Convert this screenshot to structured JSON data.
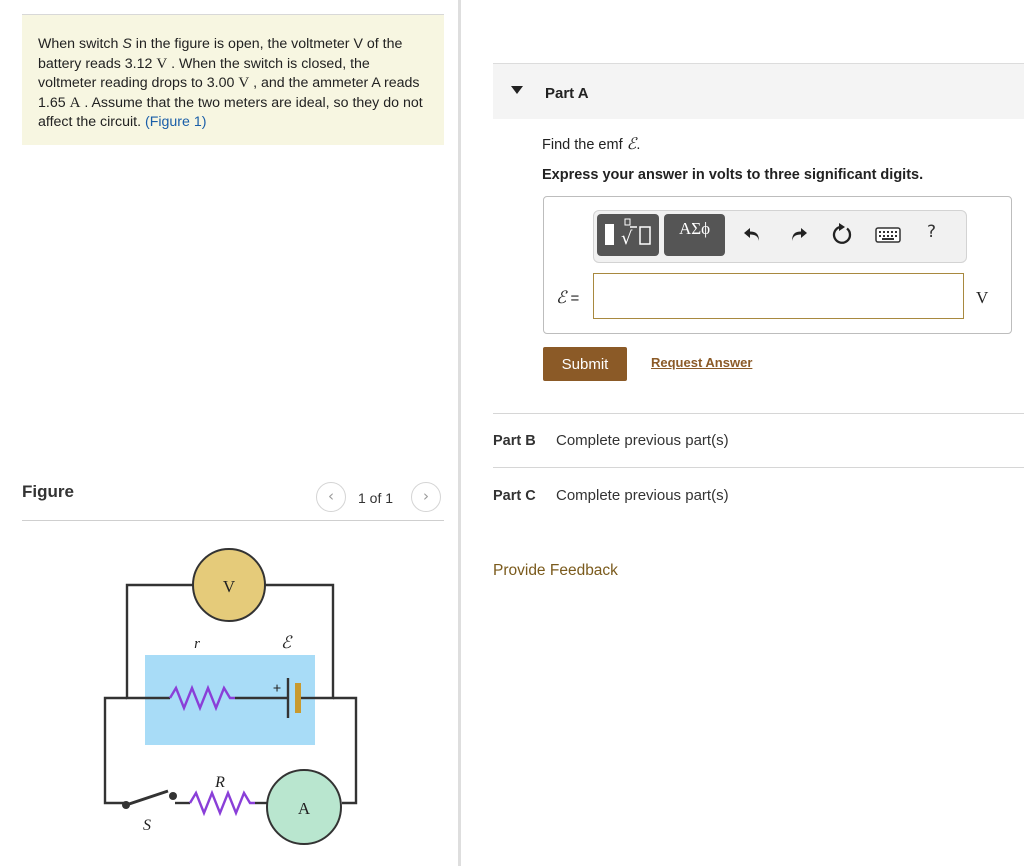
{
  "problem": {
    "s1": "When switch ",
    "s_symbol": "S",
    "s2": " in the figure is open, the voltmeter V of the battery reads 3.12 ",
    "unit_v1": "V",
    "s3": " . When the switch is closed, the voltmeter reading drops to 3.00 ",
    "unit_v2": "V",
    "s4": " , and the ammeter A reads 1.65 ",
    "unit_a": "A",
    "s5": " . Assume that the two meters are ideal, so they do not affect the circuit. ",
    "figure_link": "(Figure 1)"
  },
  "figure": {
    "title": "Figure",
    "prev_icon": "‹",
    "next_icon": "›",
    "counter": "1 of 1",
    "labels": {
      "voltmeter": "V",
      "ammeter": "A",
      "r": "r",
      "emf": "ℰ",
      "R": "R",
      "S": "S",
      "plus": "+"
    },
    "colors": {
      "voltmeter_fill": "#e5cb7a",
      "ammeter_fill": "#b9e6cf",
      "battery_box": "#a8dcf7",
      "resistor": "#8a3fd8",
      "battery_plate": "#c99a2e"
    }
  },
  "partA": {
    "label": "Part A",
    "question_prefix": "Find the emf ",
    "question_symbol": "ℰ",
    "question_suffix": ".",
    "instruction": "Express your answer in volts to three significant digits.",
    "toolbar": {
      "greek_label": "ΑΣϕ",
      "help_label": "?",
      "icons": [
        "templates-icon",
        "undo-icon",
        "redo-icon",
        "reset-icon",
        "keyboard-icon",
        "help-icon"
      ]
    },
    "eq_symbol": "ℰ",
    "eq_sign": " =",
    "answer_value": "",
    "unit": "V",
    "submit_label": "Submit",
    "request_label": "Request Answer"
  },
  "partB": {
    "label": "Part B",
    "status": "Complete previous part(s)"
  },
  "partC": {
    "label": "Part C",
    "status": "Complete previous part(s)"
  },
  "feedback_label": "Provide Feedback",
  "colors": {
    "accent_brown": "#8b5a27",
    "link_blue": "#1a5ea8",
    "problem_bg": "#f7f6e1"
  }
}
